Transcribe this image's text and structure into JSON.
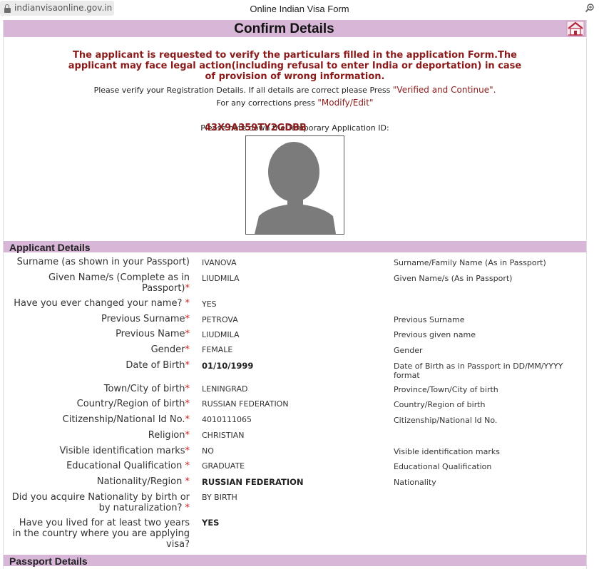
{
  "browser": {
    "url": "indianvisaonline.gov.in",
    "title": "Online Indian Visa Form"
  },
  "page": {
    "title": "Confirm Details",
    "warning": "The applicant is requested to verify the particulars filled in the application Form.The applicant may face legal action(including refusal to enter India or deportation) in case of provision of wrong information.",
    "verify_text": "Please verify your Registration Details.   If all details are correct please Press",
    "verify_action": "\"Verified and Continue\".",
    "correction_text": "For any corrections press",
    "correction_action": "\"Modify/Edit\"",
    "temp_id_label": "Please note down the Temporary Application ID:",
    "temp_id": "43X9A359TY2GDBB"
  },
  "sections": {
    "applicant": "Applicant Details",
    "passport": "Passport Details"
  },
  "applicant_rows": [
    {
      "label": "Surname (as shown in your Passport)",
      "req": "",
      "value": "IVANOVA",
      "bold": false,
      "hint": "Surname/Family Name (As in Passport)"
    },
    {
      "label": "Given Name/s (Complete as in Passport)",
      "req": "*",
      "value": "LIUDMILA",
      "bold": false,
      "hint": "Given Name/s (As in Passport)"
    },
    {
      "label": "Have you ever changed your name?",
      "req": " *",
      "value": "YES",
      "bold": false,
      "hint": ""
    },
    {
      "label": "Previous Surname",
      "req": "*",
      "value": "PETROVA",
      "bold": false,
      "hint": "Previous Surname"
    },
    {
      "label": "Previous Name",
      "req": "*",
      "value": "LIUDMILA",
      "bold": false,
      "hint": "Previous given name"
    },
    {
      "label": "Gender",
      "req": "*",
      "value": "FEMALE",
      "bold": false,
      "hint": "Gender"
    },
    {
      "label": "Date of Birth",
      "req": "*",
      "value": "01/10/1999",
      "bold": true,
      "hint": "Date of Birth as in Passport in DD/MM/YYYY format"
    },
    {
      "label": "Town/City of birth",
      "req": "*",
      "value": "LENINGRAD",
      "bold": false,
      "hint": "Province/Town/City of birth"
    },
    {
      "label": "Country/Region of birth",
      "req": "*",
      "value": "RUSSIAN FEDERATION",
      "bold": false,
      "hint": "Country/Region of birth"
    },
    {
      "label": "Citizenship/National Id No.",
      "req": "*",
      "value": "4010111065",
      "bold": false,
      "hint": "Citizenship/National Id No."
    },
    {
      "label": "Religion",
      "req": "*",
      "value": "CHRISTIAN",
      "bold": false,
      "hint": ""
    },
    {
      "label": "Visible identification marks",
      "req": "*",
      "value": "NO",
      "bold": false,
      "hint": "Visible identification marks"
    },
    {
      "label": "Educational Qualification",
      "req": " *",
      "value": "GRADUATE",
      "bold": false,
      "hint": "Educational Qualification"
    },
    {
      "label": "Nationality/Region",
      "req": " *",
      "value": "RUSSIAN FEDERATION",
      "bold": true,
      "hint": "Nationality"
    },
    {
      "label": "Did you acquire Nationality by birth or by naturalization?",
      "req": " *",
      "value": "BY BIRTH",
      "bold": false,
      "hint": ""
    },
    {
      "label": "Have you lived for at least two years in the country where you are applying visa?",
      "req": "",
      "value": "YES",
      "bold": true,
      "hint": ""
    }
  ],
  "colors": {
    "header_bg": "#d8b6d8",
    "warning": "#8b1a1a",
    "required": "#cc2222"
  }
}
